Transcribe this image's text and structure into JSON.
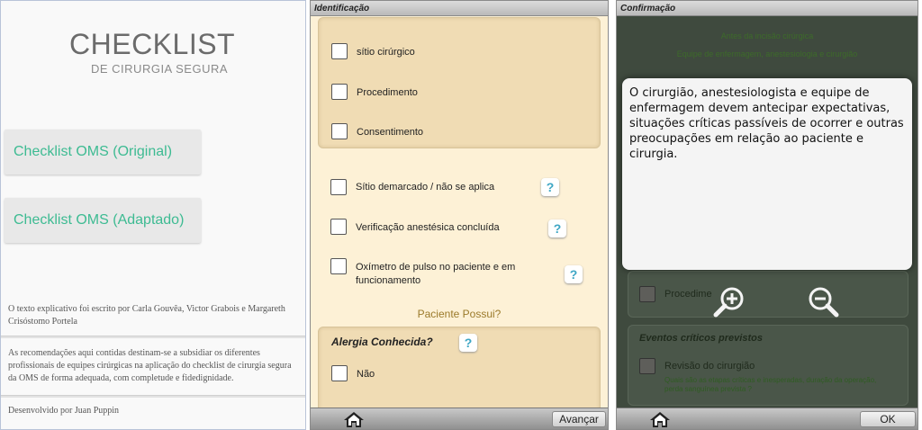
{
  "home": {
    "logo_title": "CHECKLIST",
    "logo_subtitle": "DE CIRURGIA SEGURA",
    "btn_original": "Checklist OMS (Original)",
    "btn_adapted": "Checklist OMS (Adaptado)",
    "credits": "O texto explicativo foi escrito por Carla Gouvêa, Victor Grabois e Margareth Crisóstomo Portela",
    "recommendations": "As recomendações aqui contidas destinam-se a subsidiar os diferentes profissionais de equipes cirúrgicas na aplicação do checklist de cirurgia segura da OMS de forma adequada, com completude e fidedignidade.",
    "developer": "Desenvolvido por Juan Puppin"
  },
  "identificacao": {
    "title": "Identificação",
    "group1": [
      "sítio cirúrgico",
      "Procedimento",
      "Consentimento"
    ],
    "item_sitio": "Sítio demarcado / não se aplica",
    "item_anestesica": "Verificação anestésica concluída",
    "item_oximetro": "Oxímetro de pulso no paciente e em funcionamento",
    "help_glyph": "?",
    "paciente_heading": "Paciente Possui?",
    "alergia_title": "Alergia Conhecida?",
    "alergia_option": "Não",
    "next_button": "Avançar"
  },
  "confirmacao": {
    "title": "Confirmação",
    "heading1": "Antes da incisão cirúrgica",
    "heading2": "Equipe de enfermagem, anestesiologia e cirurgião",
    "popup_text": "O cirurgião, anestesiologista e equipe de enfermagem devem antecipar expectativas, situações críticas passíveis de ocorrer e outras preocupações em relação ao paciente e cirurgia.",
    "item_procedimento": "Procedime",
    "eventos_title": "Eventos críticos previstos",
    "revisao_label": "Revisão do cirurgião",
    "revisao_detail": "Quais são as etapas críticas e inesperadas, duração da operação, perda sanguínea prevista ?",
    "ok_button": "OK"
  },
  "colors": {
    "accent_green": "#3dbb92",
    "help_blue": "#3da6c4",
    "panel_cream": "#fdf1d6"
  },
  "icons": [
    "home-icon",
    "help-icon",
    "zoom-in-icon",
    "zoom-out-icon"
  ]
}
